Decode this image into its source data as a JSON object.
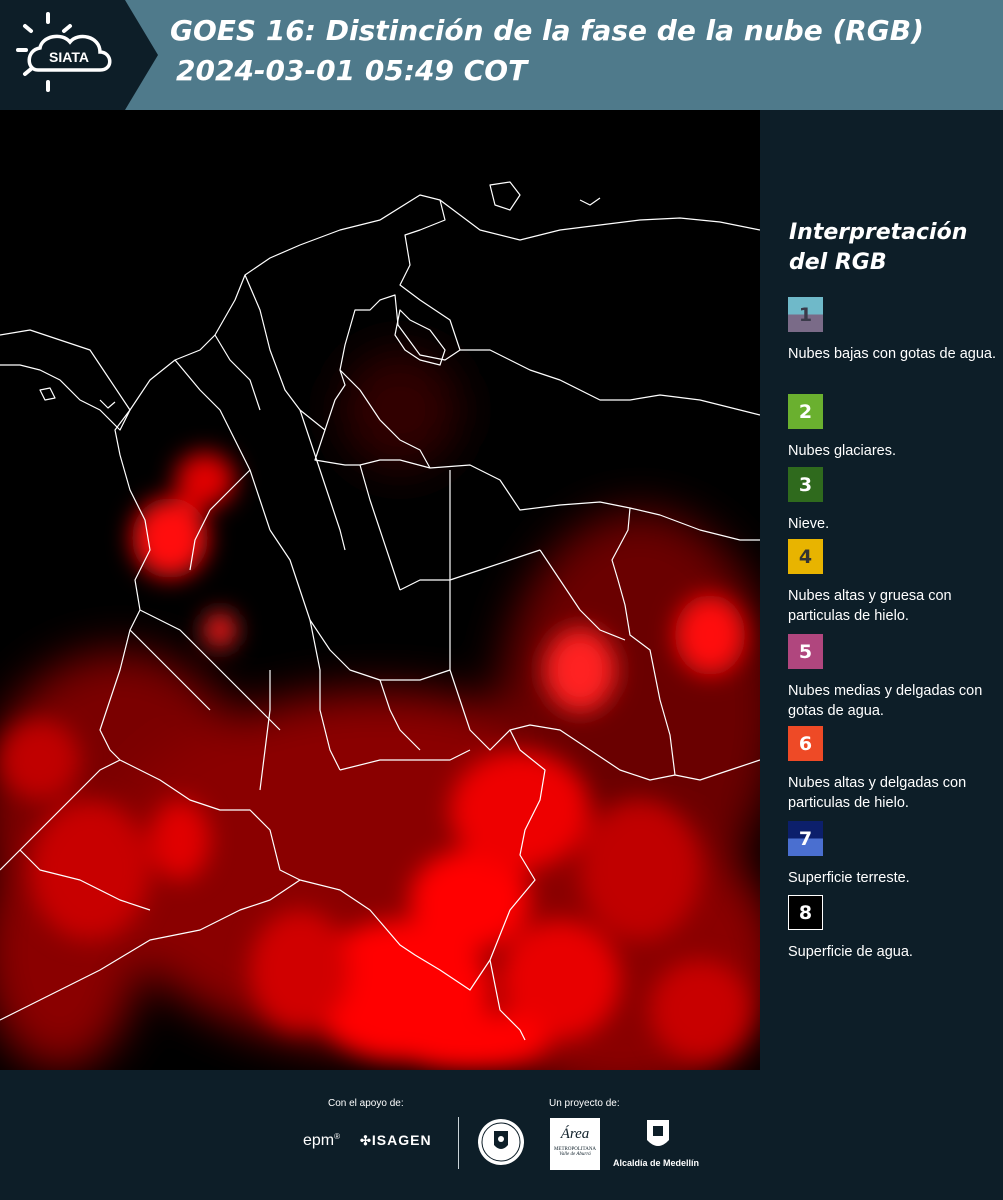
{
  "header": {
    "brand": "SIATA",
    "title_line1": "GOES 16: Distinción de la fase de la nube (RGB)",
    "title_line2": "2024-03-01 05:49 COT",
    "background": "#4f7a8b"
  },
  "map": {
    "background": "#000000",
    "cloud_color": "#ff0000",
    "border_color": "#ffffff"
  },
  "legend": {
    "title_line1": "Interpretación",
    "title_line2": "del RGB",
    "items": [
      {
        "number": "1",
        "label": "Nubes bajas con gotas de agua.",
        "color_top": "#6fb9c9",
        "color_bottom": "#7a6b88",
        "text_color": "#3a3a4a"
      },
      {
        "number": "2",
        "label": "Nubes glaciares.",
        "color_top": "#6ab02f",
        "color_bottom": "#6ab02f",
        "text_color": "#ffffff"
      },
      {
        "number": "3",
        "label": "Nieve.",
        "color_top": "#2f6a1d",
        "color_bottom": "#2f6a1d",
        "text_color": "#ffffff"
      },
      {
        "number": "4",
        "label": "Nubes altas y gruesa con particulas de hielo.",
        "color_top": "#e8b400",
        "color_bottom": "#e8b400",
        "text_color": "#333333"
      },
      {
        "number": "5",
        "label": "Nubes medias y delgadas con gotas de agua.",
        "color_top": "#b0467e",
        "color_bottom": "#b0467e",
        "text_color": "#ffffff"
      },
      {
        "number": "6",
        "label": "Nubes altas y delgadas con particulas de hielo.",
        "color_top": "#ee4a26",
        "color_bottom": "#ee4a26",
        "text_color": "#ffffff"
      },
      {
        "number": "7",
        "label": "Superficie terreste.",
        "color_top": "#0c1f6b",
        "color_bottom": "#4a6fd0",
        "text_color": "#ffffff"
      },
      {
        "number": "8",
        "label": "Superficie de agua.",
        "color_top": "#000000",
        "color_bottom": "#000000",
        "text_color": "#ffffff"
      }
    ]
  },
  "footer": {
    "support_label": "Con el apoyo de:",
    "project_label": "Un proyecto de:",
    "sponsor_epm": "epm",
    "sponsor_isagen": "ISAGEN",
    "area_name": "Área",
    "area_sub1": "METROPOLITANA",
    "area_sub2": "Valle de Aburrá",
    "alcaldia": "Alcaldía de Medellín"
  }
}
